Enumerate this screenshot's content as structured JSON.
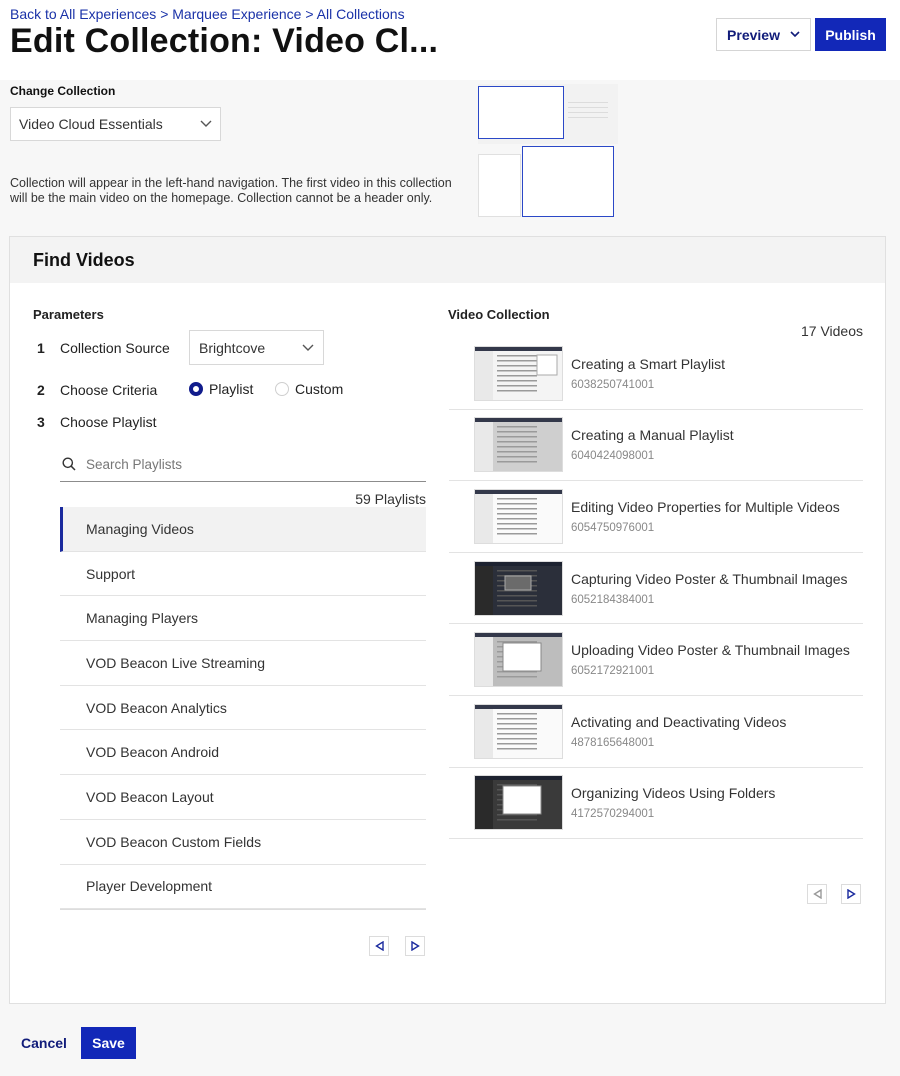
{
  "breadcrumb": {
    "items": [
      "Back to All Experiences",
      "Marquee Experience",
      "All Collections"
    ],
    "separator": ">"
  },
  "page_title": "Edit Collection: Video Cl...",
  "toolbar": {
    "preview_label": "Preview",
    "publish_label": "Publish"
  },
  "collection": {
    "change_label": "Change Collection",
    "selected": "Video Cloud Essentials",
    "description": "Collection will appear in the left-hand navigation. The first video in this collection will be the main video on the homepage. Collection cannot be a header only."
  },
  "find_videos": {
    "title": "Find Videos",
    "parameters_title": "Parameters",
    "steps": [
      {
        "num": "1",
        "label": "Collection Source"
      },
      {
        "num": "2",
        "label": "Choose Criteria"
      },
      {
        "num": "3",
        "label": "Choose Playlist"
      }
    ],
    "source_selected": "Brightcove",
    "criteria_options": [
      {
        "label": "Playlist",
        "checked": true
      },
      {
        "label": "Custom",
        "checked": false
      }
    ],
    "search_placeholder": "Search Playlists",
    "playlist_count": "59 Playlists",
    "playlists": [
      "Managing Videos",
      "Support",
      "Managing Players",
      "VOD Beacon Live Streaming",
      "VOD Beacon Analytics",
      "VOD Beacon Android",
      "VOD Beacon Layout",
      "VOD Beacon Custom Fields",
      "Player Development"
    ],
    "active_playlist_index": 0
  },
  "video_collection": {
    "title": "Video Collection",
    "count": "17 Videos",
    "videos": [
      {
        "title": "Creating a Smart Playlist",
        "id": "6038250741001",
        "thumb": "light"
      },
      {
        "title": "Creating a Manual Playlist",
        "id": "6040424098001",
        "thumb": "grey"
      },
      {
        "title": "Editing Video Properties for Multiple Videos",
        "id": "6054750976001",
        "thumb": "white"
      },
      {
        "title": "Capturing Video Poster & Thumbnail Images",
        "id": "6052184384001",
        "thumb": "dark"
      },
      {
        "title": "Uploading Video Poster & Thumbnail Images",
        "id": "6052172921001",
        "thumb": "dialog"
      },
      {
        "title": "Activating and Deactivating Videos",
        "id": "4878165648001",
        "thumb": "white"
      },
      {
        "title": "Organizing Videos Using Folders",
        "id": "4172570294001",
        "thumb": "darkdialog"
      }
    ]
  },
  "footer": {
    "cancel_label": "Cancel",
    "save_label": "Save"
  },
  "colors": {
    "primary": "#1228b8",
    "link": "#1a32a8",
    "active_bar": "#1a2a9e"
  },
  "icons": {
    "preview_chevron": "chevron-down-icon",
    "select_chevron": "chevron-down-icon",
    "search": "search-icon",
    "prev": "triangle-left-icon",
    "next": "triangle-right-icon"
  }
}
